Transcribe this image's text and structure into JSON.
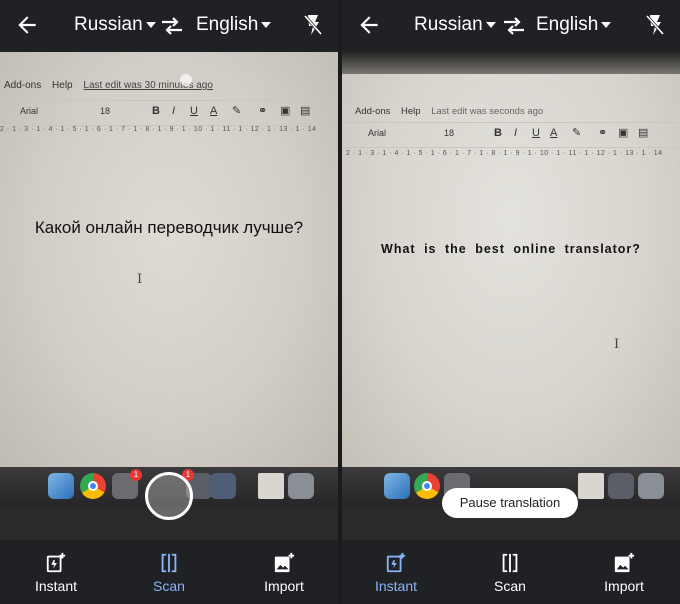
{
  "left": {
    "header": {
      "source_lang": "Russian",
      "target_lang": "English"
    },
    "document": {
      "menu": [
        "Add-ons",
        "Help"
      ],
      "last_edit": "Last edit was 30 minutes ago",
      "font": "Arial",
      "font_size": "18",
      "toolbar_buttons": [
        "B",
        "I",
        "U",
        "A"
      ],
      "ruler": "2 · 1 · 3 · 1 · 4 · 1 · 5 · 1 · 6 · 1 · 7 · 1 · 8 · 1 · 9 · 1 · 10 · 1 · 11 · 1 · 12 · 1 · 13 · 1 · 14",
      "text": "Какой онлайн переводчик лучше?",
      "cursor": "I"
    },
    "dock_badges": [
      "1",
      "1"
    ],
    "nav": [
      {
        "label": "Instant",
        "icon": "instant-icon"
      },
      {
        "label": "Scan",
        "icon": "scan-icon"
      },
      {
        "label": "Import",
        "icon": "import-icon"
      }
    ],
    "active_tab": "Scan"
  },
  "right": {
    "header": {
      "source_lang": "Russian",
      "target_lang": "English"
    },
    "document": {
      "menu": [
        "Add-ons",
        "Help"
      ],
      "last_edit": "Last edit was seconds ago",
      "font": "Arial",
      "font_size": "18",
      "toolbar_buttons": [
        "B",
        "I",
        "U",
        "A"
      ],
      "ruler": "2 · 1 · 3 · 1 · 4 · 1 · 5 · 1 · 6 · 1 · 7 · 1 · 8 · 1 · 9 · 1 · 10 · 1 · 11 · 1 · 12 · 1 · 13 · 1 · 14",
      "text": "What is the best online translator?",
      "cursor": "I"
    },
    "pause_button": "Pause translation",
    "nav": [
      {
        "label": "Instant",
        "icon": "instant-icon"
      },
      {
        "label": "Scan",
        "icon": "scan-icon"
      },
      {
        "label": "Import",
        "icon": "import-icon"
      }
    ],
    "active_tab": "Instant"
  },
  "colors": {
    "active": "#8ab4f8",
    "bar": "#202124"
  }
}
